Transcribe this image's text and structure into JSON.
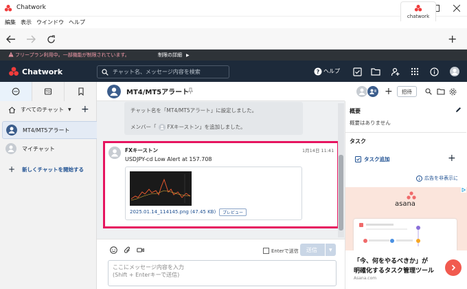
{
  "window": {
    "title": "Chatwork"
  },
  "menu": [
    "編集",
    "表示",
    "ウインドウ",
    "ヘルプ"
  ],
  "browser_tab": {
    "label": "chatwork"
  },
  "banner": {
    "text": "フリープラン利用中。一部機能が制限されています。",
    "link": "制限の詳細"
  },
  "header": {
    "brand": "Chatwork",
    "search_placeholder": "チャット名、メッセージ内容を検索",
    "help_label": "ヘルプ"
  },
  "sidebar": {
    "all_chats_label": "すべてのチャット",
    "rooms": [
      {
        "label": "MT4/MT5アラート",
        "selected": true
      },
      {
        "label": "マイチャット",
        "selected": false
      }
    ],
    "new_chat_label": "新しくチャットを開始する"
  },
  "chat": {
    "title": "MT4/MT5アラート",
    "invite_label": "招待",
    "system_messages": [
      "チャット名を「MT4/MT5アラート」に設定しました。",
      "メンバー「",
      "FXキーストン",
      "」を追加しました。"
    ],
    "message": {
      "sender": "FXキーストン",
      "time": "1月14日 11:41",
      "body": "USDJPY-cd  Low Alert at 157.708",
      "file_name": "2025.01.14_114145.png (47.45 KB)",
      "preview_label": "プレビュー"
    }
  },
  "composer": {
    "enter_label": "Enterで送信",
    "send_label": "送信",
    "placeholder": "ここにメッセージ内容を入力\n(Shift + Enterキーで送信)"
  },
  "right_panel": {
    "overview_title": "概要",
    "overview_text": "概要はありません",
    "task_title": "タスク",
    "task_add_label": "タスク追加",
    "ad_hide_label": "広告を非表示に",
    "ad": {
      "brand": "asana",
      "line1": "「今、何をやるべきか」が",
      "line2": "明確化するタスク管理ツール",
      "url": "Asana.com"
    }
  },
  "colors": {
    "header_bg": "#1d2a3a",
    "banner_bg": "#2e3338",
    "highlight": "#e6145f",
    "accent_red": "#f15a4f"
  }
}
